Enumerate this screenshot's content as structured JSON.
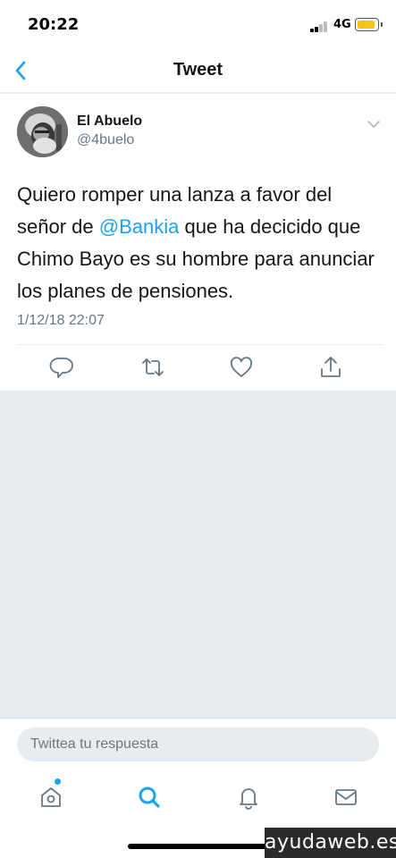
{
  "status_bar": {
    "time": "20:22",
    "network": "4G"
  },
  "nav": {
    "title": "Tweet",
    "back_icon": "chevron-left-icon"
  },
  "tweet": {
    "author_name": "El Abuelo",
    "author_handle": "@4buelo",
    "text_before": "Quiero romper una lanza a favor del señor de ",
    "mention": "@Bankia",
    "text_after": " que ha decicido que Chimo Bayo es su hombre para anunciar los planes de pensiones.",
    "date": "1/12/18 22:07",
    "actions": [
      "reply-icon",
      "retweet-icon",
      "like-icon",
      "share-icon"
    ]
  },
  "reply": {
    "placeholder": "Twittea tu respuesta"
  },
  "tabbar": {
    "tabs": [
      "home-icon",
      "search-icon",
      "notifications-icon",
      "messages-icon"
    ]
  },
  "watermark": "ayudaweb.es",
  "colors": {
    "accent": "#1da1f2",
    "secondary_text": "#657786",
    "background": "#e6ecf0"
  }
}
